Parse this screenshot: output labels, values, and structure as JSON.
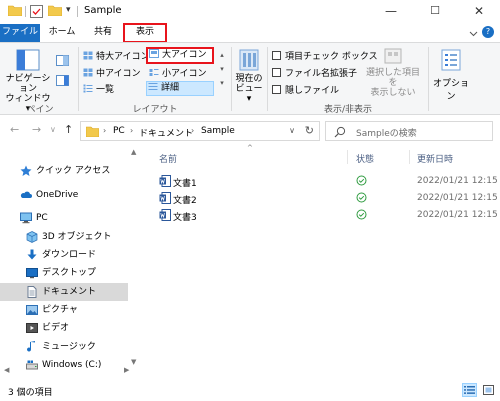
{
  "window": {
    "title": "Sample",
    "minimize": "—",
    "maximize": "☐",
    "close": "✕"
  },
  "qat": {
    "dropdown": "▾"
  },
  "tabs": [
    {
      "label": "ファイル",
      "active": false
    },
    {
      "label": "ホーム",
      "active": false
    },
    {
      "label": "共有",
      "active": false
    },
    {
      "label": "表示",
      "active": true,
      "highlighted": true
    }
  ],
  "ribbon": {
    "pane": {
      "nav_pane_label": "ナビゲーション\nウィンドウ▾",
      "group": "ペイン"
    },
    "layout": {
      "items": [
        {
          "label": "特大アイコン",
          "state": "normal"
        },
        {
          "label": "大アイコン",
          "state": "highlighted"
        },
        {
          "label": "中アイコン",
          "state": "normal"
        },
        {
          "label": "小アイコン",
          "state": "normal"
        },
        {
          "label": "一覧",
          "state": "normal"
        },
        {
          "label": "詳細",
          "state": "selected"
        }
      ],
      "group": "レイアウト"
    },
    "current_view": {
      "label": "現在の\nビュー▾"
    },
    "show_hide": {
      "checkboxes": [
        {
          "label": "項目チェック ボックス",
          "checked": false
        },
        {
          "label": "ファイル名拡張子",
          "checked": false
        },
        {
          "label": "隠しファイル",
          "checked": false
        }
      ],
      "hide_selected": "選択した項目を\n表示しない",
      "group": "表示/非表示"
    },
    "options": {
      "label": "オプション"
    }
  },
  "navigation": {
    "back": "←",
    "forward": "→",
    "recent": "∨",
    "up": "↑",
    "path": [
      "PC",
      "ドキュメント",
      "Sample"
    ],
    "path_sep": "›",
    "dropdown": "∨",
    "refresh": "↻",
    "search_placeholder": "Sampleの検索"
  },
  "sidebar": {
    "items": [
      {
        "label": "クイック アクセス",
        "icon": "star-icon",
        "indent": 0,
        "selected": false
      },
      {
        "label": "OneDrive",
        "icon": "cloud-icon",
        "indent": 0,
        "selected": false
      },
      {
        "label": "PC",
        "icon": "pc-icon",
        "indent": 0,
        "selected": false
      },
      {
        "label": "3D オブジェクト",
        "icon": "cube-icon",
        "indent": 1,
        "selected": false
      },
      {
        "label": "ダウンロード",
        "icon": "download-icon",
        "indent": 1,
        "selected": false
      },
      {
        "label": "デスクトップ",
        "icon": "desktop-icon",
        "indent": 1,
        "selected": false
      },
      {
        "label": "ドキュメント",
        "icon": "document-icon",
        "indent": 1,
        "selected": true
      },
      {
        "label": "ピクチャ",
        "icon": "picture-icon",
        "indent": 1,
        "selected": false
      },
      {
        "label": "ビデオ",
        "icon": "video-icon",
        "indent": 1,
        "selected": false
      },
      {
        "label": "ミュージック",
        "icon": "music-icon",
        "indent": 1,
        "selected": false
      },
      {
        "label": "Windows (C:)",
        "icon": "drive-icon",
        "indent": 1,
        "selected": false
      }
    ],
    "scroll_up": "▲",
    "scroll_down": "▼",
    "scroll_left": "◀",
    "scroll_right": "▶"
  },
  "file_list": {
    "columns": [
      "名前",
      "状態",
      "更新日時"
    ],
    "sort_caret": "^",
    "rows": [
      {
        "name": "文書1",
        "status": "synced",
        "modified": "2022/01/21 12:15"
      },
      {
        "name": "文書2",
        "status": "synced",
        "modified": "2022/01/21 12:15"
      },
      {
        "name": "文書3",
        "status": "synced",
        "modified": "2022/01/21 12:15"
      }
    ]
  },
  "statusbar": {
    "item_count": "3 個の項目",
    "active_view": "details"
  },
  "colors": {
    "accent": "#1a6fc4",
    "highlight_red": "#e8141c",
    "selection": "#cce8ff",
    "sync_green": "#2e9b3f",
    "folder_yellow": "#f2c94c"
  }
}
